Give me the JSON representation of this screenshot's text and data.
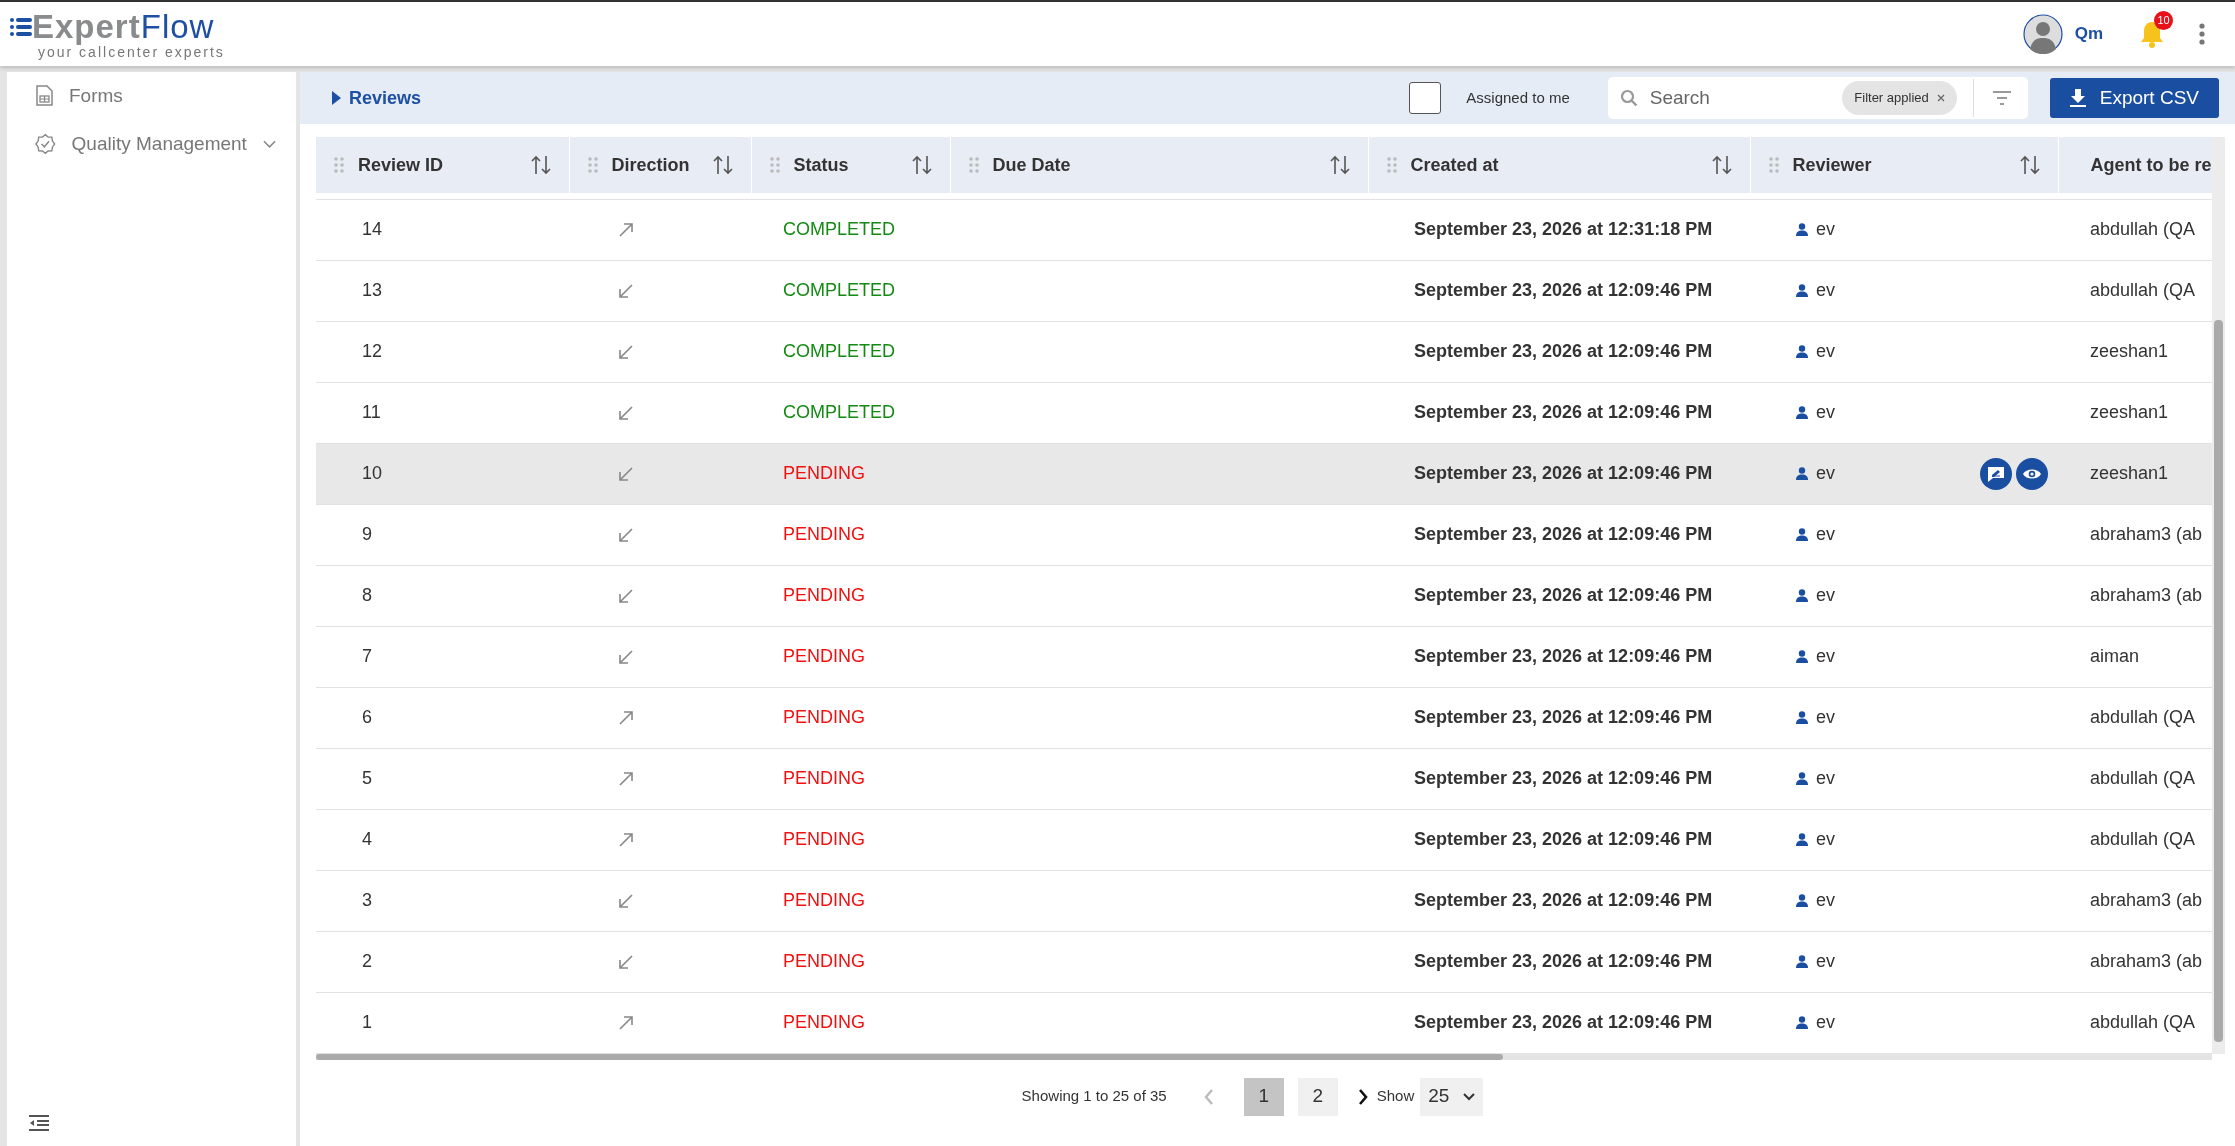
{
  "header": {
    "logo_brand_a": "Expert",
    "logo_brand_b": "Flow",
    "logo_tagline": "your callcenter experts",
    "user": "Qm",
    "notifications": "10"
  },
  "sidebar": {
    "items": [
      {
        "label": "Forms",
        "kind": "form"
      },
      {
        "label": "Quality Management",
        "kind": "quality",
        "expanded": false
      }
    ]
  },
  "toolbar": {
    "breadcrumb": "Reviews",
    "assigned_to_me": {
      "label": "Assigned to me",
      "checked": false
    },
    "search": {
      "placeholder": "Search"
    },
    "filter_chip": "Filter applied",
    "export_button": "Export CSV"
  },
  "table": {
    "columns": [
      {
        "label": "Review ID",
        "sortable": true
      },
      {
        "label": "Direction",
        "sortable": true
      },
      {
        "label": "Status",
        "sortable": true
      },
      {
        "label": "Due Date",
        "sortable": true
      },
      {
        "label": "Created at",
        "sortable": true
      },
      {
        "label": "Reviewer",
        "sortable": true
      },
      {
        "label": "Agent to be re"
      }
    ],
    "rows": [
      {
        "id": "14",
        "direction": {
          "kind": "outbound"
        },
        "status": {
          "label": "COMPLETED",
          "kind": "completed"
        },
        "created": "September 23, 2026 at 12:31:18 PM",
        "reviewer": "ev",
        "agent": "abdullah (QA",
        "hovered": false
      },
      {
        "id": "13",
        "direction": {
          "kind": "inbound"
        },
        "status": {
          "label": "COMPLETED",
          "kind": "completed"
        },
        "created": "September 23, 2026 at 12:09:46 PM",
        "reviewer": "ev",
        "agent": "abdullah (QA",
        "hovered": false
      },
      {
        "id": "12",
        "direction": {
          "kind": "inbound"
        },
        "status": {
          "label": "COMPLETED",
          "kind": "completed"
        },
        "created": "September 23, 2026 at 12:09:46 PM",
        "reviewer": "ev",
        "agent": "zeeshan1",
        "hovered": false
      },
      {
        "id": "11",
        "direction": {
          "kind": "inbound"
        },
        "status": {
          "label": "COMPLETED",
          "kind": "completed"
        },
        "created": "September 23, 2026 at 12:09:46 PM",
        "reviewer": "ev",
        "agent": "zeeshan1",
        "hovered": false
      },
      {
        "id": "10",
        "direction": {
          "kind": "inbound"
        },
        "status": {
          "label": "PENDING",
          "kind": "pending"
        },
        "created": "September 23, 2026 at 12:09:46 PM",
        "reviewer": "ev",
        "agent": "zeeshan1",
        "hovered": true
      },
      {
        "id": "9",
        "direction": {
          "kind": "inbound"
        },
        "status": {
          "label": "PENDING",
          "kind": "pending"
        },
        "created": "September 23, 2026 at 12:09:46 PM",
        "reviewer": "ev",
        "agent": "abraham3 (ab",
        "hovered": false
      },
      {
        "id": "8",
        "direction": {
          "kind": "inbound"
        },
        "status": {
          "label": "PENDING",
          "kind": "pending"
        },
        "created": "September 23, 2026 at 12:09:46 PM",
        "reviewer": "ev",
        "agent": "abraham3 (ab",
        "hovered": false
      },
      {
        "id": "7",
        "direction": {
          "kind": "inbound"
        },
        "status": {
          "label": "PENDING",
          "kind": "pending"
        },
        "created": "September 23, 2026 at 12:09:46 PM",
        "reviewer": "ev",
        "agent": "aiman",
        "hovered": false
      },
      {
        "id": "6",
        "direction": {
          "kind": "outbound"
        },
        "status": {
          "label": "PENDING",
          "kind": "pending"
        },
        "created": "September 23, 2026 at 12:09:46 PM",
        "reviewer": "ev",
        "agent": "abdullah (QA",
        "hovered": false
      },
      {
        "id": "5",
        "direction": {
          "kind": "outbound"
        },
        "status": {
          "label": "PENDING",
          "kind": "pending"
        },
        "created": "September 23, 2026 at 12:09:46 PM",
        "reviewer": "ev",
        "agent": "abdullah (QA",
        "hovered": false
      },
      {
        "id": "4",
        "direction": {
          "kind": "outbound"
        },
        "status": {
          "label": "PENDING",
          "kind": "pending"
        },
        "created": "September 23, 2026 at 12:09:46 PM",
        "reviewer": "ev",
        "agent": "abdullah (QA",
        "hovered": false
      },
      {
        "id": "3",
        "direction": {
          "kind": "inbound"
        },
        "status": {
          "label": "PENDING",
          "kind": "pending"
        },
        "created": "September 23, 2026 at 12:09:46 PM",
        "reviewer": "ev",
        "agent": "abraham3 (ab",
        "hovered": false
      },
      {
        "id": "2",
        "direction": {
          "kind": "inbound"
        },
        "status": {
          "label": "PENDING",
          "kind": "pending"
        },
        "created": "September 23, 2026 at 12:09:46 PM",
        "reviewer": "ev",
        "agent": "abraham3 (ab",
        "hovered": false
      },
      {
        "id": "1",
        "direction": {
          "kind": "outbound"
        },
        "status": {
          "label": "PENDING",
          "kind": "pending"
        },
        "created": "September 23, 2026 at 12:09:46 PM",
        "reviewer": "ev",
        "agent": "abdullah (QA",
        "hovered": false
      }
    ]
  },
  "pagination": {
    "summary": "Showing 1 to 25 of 35",
    "pages": [
      {
        "label": "1",
        "selected": true
      },
      {
        "label": "2",
        "selected": false
      }
    ],
    "prev_disabled": true,
    "next_disabled": false,
    "show_label": "Show",
    "page_size": "25"
  }
}
